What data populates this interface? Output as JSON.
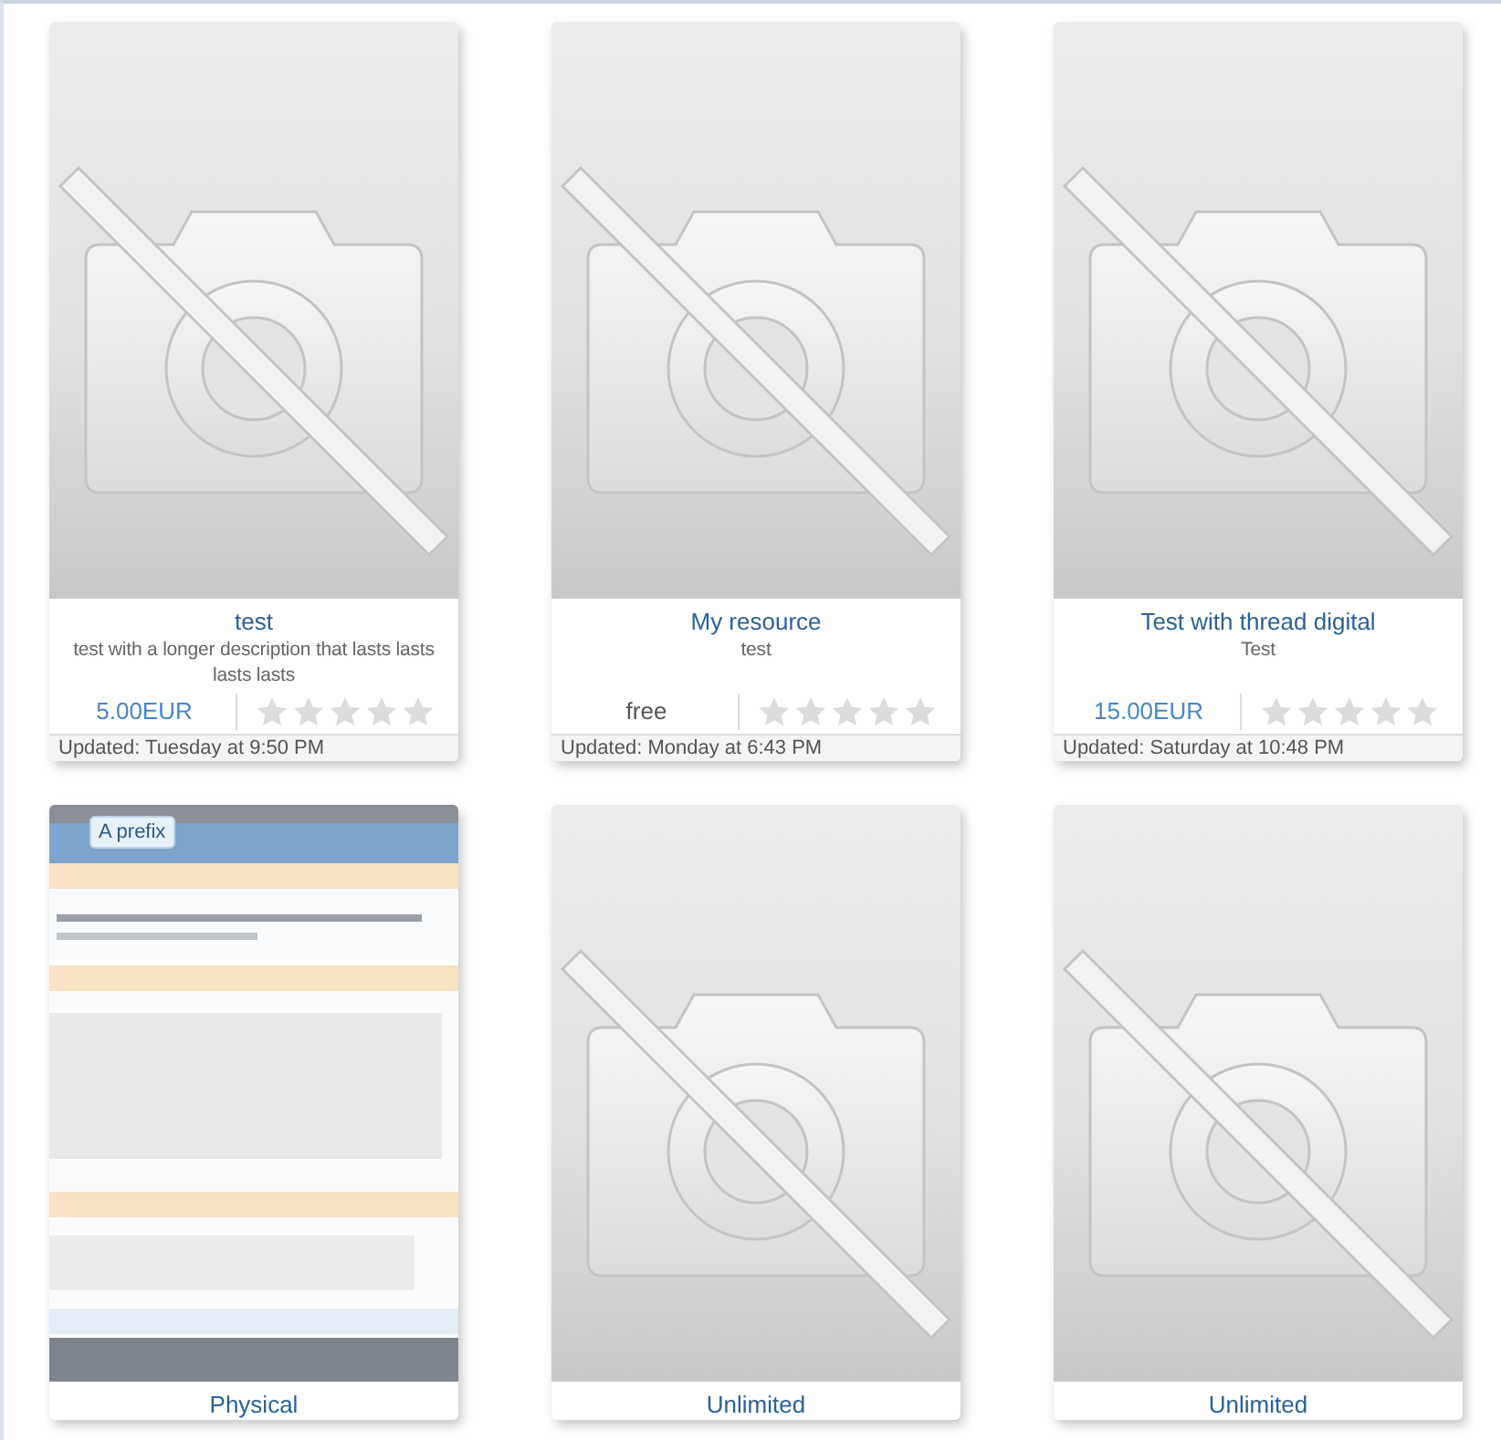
{
  "resources": [
    {
      "thumbnail": {
        "kind": "placeholder"
      },
      "title": "test",
      "description": "test with a longer description that lasts lasts lasts lasts",
      "price": {
        "text": "5.00EUR",
        "kind": "paid"
      },
      "stars": 0,
      "updated": "Updated: Tuesday at 9:50 PM"
    },
    {
      "thumbnail": {
        "kind": "placeholder"
      },
      "title": "My resource",
      "description": "test",
      "price": {
        "text": "free",
        "kind": "free"
      },
      "stars": 0,
      "updated": "Updated: Monday at 6:43 PM"
    },
    {
      "thumbnail": {
        "kind": "placeholder"
      },
      "title": "Test with thread digital",
      "description": "Test",
      "price": {
        "text": "15.00EUR",
        "kind": "paid"
      },
      "stars": 0,
      "updated": "Updated: Saturday at 10:48 PM"
    },
    {
      "prefix": "A prefix",
      "title": "Physical"
    },
    {
      "thumbnail": {
        "kind": "placeholder"
      },
      "title": "Unlimited"
    },
    {
      "thumbnail": {
        "kind": "placeholder"
      },
      "title": "Unlimited"
    }
  ]
}
